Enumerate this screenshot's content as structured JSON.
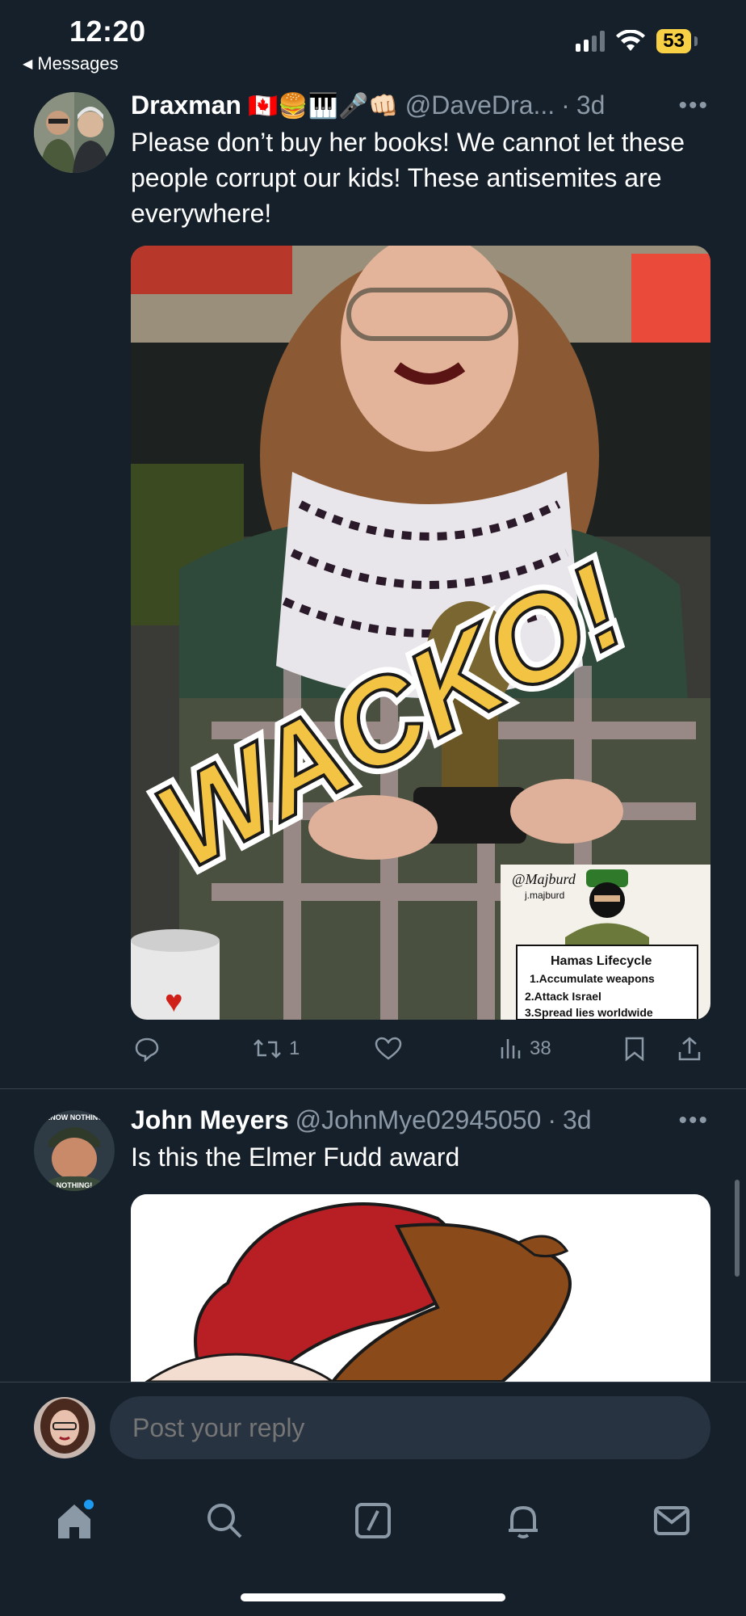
{
  "status_bar": {
    "time": "12:20",
    "back_label": "Messages",
    "battery": "53"
  },
  "tweets": [
    {
      "display_name": "Draxman",
      "emojis": "🇨🇦🍔🎹🎤👊🏻",
      "handle": "@DaveDra...",
      "separator": "·",
      "age": "3d",
      "text": "Please don’t buy her books! We cannot let these people corrupt our kids! These antisemites are everywhere!",
      "media": {
        "overlay_word": "WACKO!",
        "inset_brand": "@Majburd",
        "inset_handle": "j.majburd",
        "inset_title": "Hamas Lifecycle",
        "inset_steps": [
          "1.Accumulate weapons",
          "2.Attack Israel",
          "3.Spread lies worldwide"
        ]
      },
      "actions": {
        "replies": "",
        "retweets": "1",
        "likes": "",
        "views": "38"
      }
    },
    {
      "display_name": "John Meyers",
      "handle": "@JohnMye02945050",
      "separator": "·",
      "age": "3d",
      "text": "Is this the Elmer Fudd award",
      "avatar_text_top": "KNOW NOTHING",
      "avatar_text_bottom": "NOTHING!"
    }
  ],
  "reply": {
    "placeholder": "Post your reply"
  },
  "tabs": [
    "home-icon",
    "search-icon",
    "compose-icon",
    "notifications-icon",
    "messages-icon"
  ],
  "colors": {
    "background": "#15202b",
    "secondary_text": "#8b98a5",
    "divider": "#38444d",
    "accent": "#1d9bf0"
  }
}
